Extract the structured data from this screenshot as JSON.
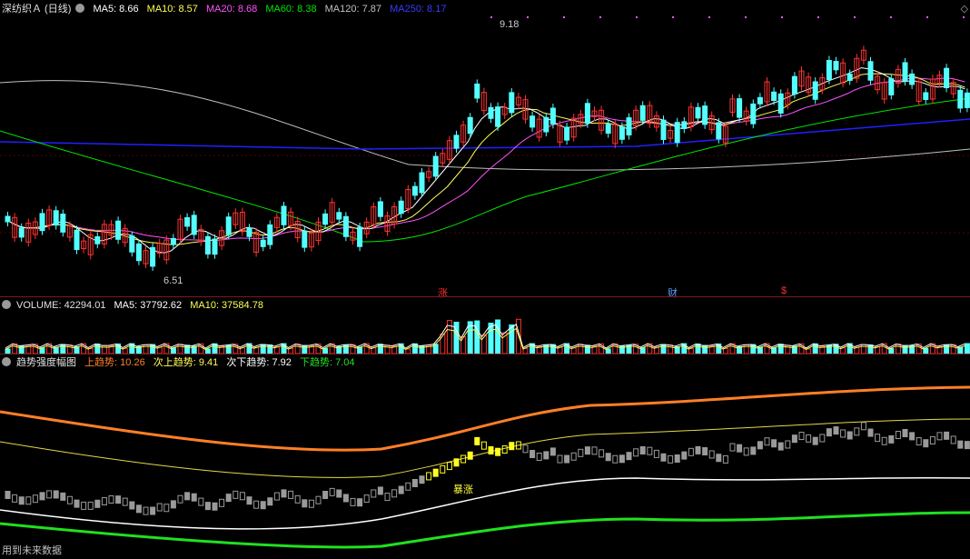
{
  "main_header": {
    "title": "深纺织Ａ (日线)",
    "ma5": "MA5: 8.66",
    "ma10": "MA10: 8.57",
    "ma20": "MA20: 8.68",
    "ma60": "MA60: 8.38",
    "ma120": "MA120: 7.87",
    "ma250": "MA250: 8.17"
  },
  "price_labels": {
    "high": "9.18",
    "low": "6.51"
  },
  "event_markers": [
    {
      "label": "涨",
      "color": "#ff3030"
    },
    {
      "label": "财",
      "color": "#5aa0ff"
    },
    {
      "label": "$",
      "color": "#ff3030"
    }
  ],
  "volume_header": {
    "title": "VOLUME: 42294.01",
    "ma5": "MA5: 37792.62",
    "ma10": "MA10: 37584.78"
  },
  "trend_header": {
    "title": "趋势强度幅图",
    "up": "上趋势: 10.26",
    "sub_up": "次上趋势: 9.41",
    "sub_down": "次下趋势: 7.92",
    "down": "下趋势: 7.04"
  },
  "trend_annotation": "暴涨",
  "footer": "用到未来数据",
  "colors": {
    "up": "#ff3232",
    "down": "#54ffff",
    "ma5": "#ffffff",
    "ma10": "#ffff54",
    "ma20": "#ff54ff",
    "ma60": "#00e600",
    "ma120": "#c0c0c0",
    "ma250": "#2020ff",
    "trend_up": "#ff7f27",
    "trend_subup": "#e6d84a",
    "trend_subdown": "#ffffff",
    "trend_down": "#20e020"
  }
}
